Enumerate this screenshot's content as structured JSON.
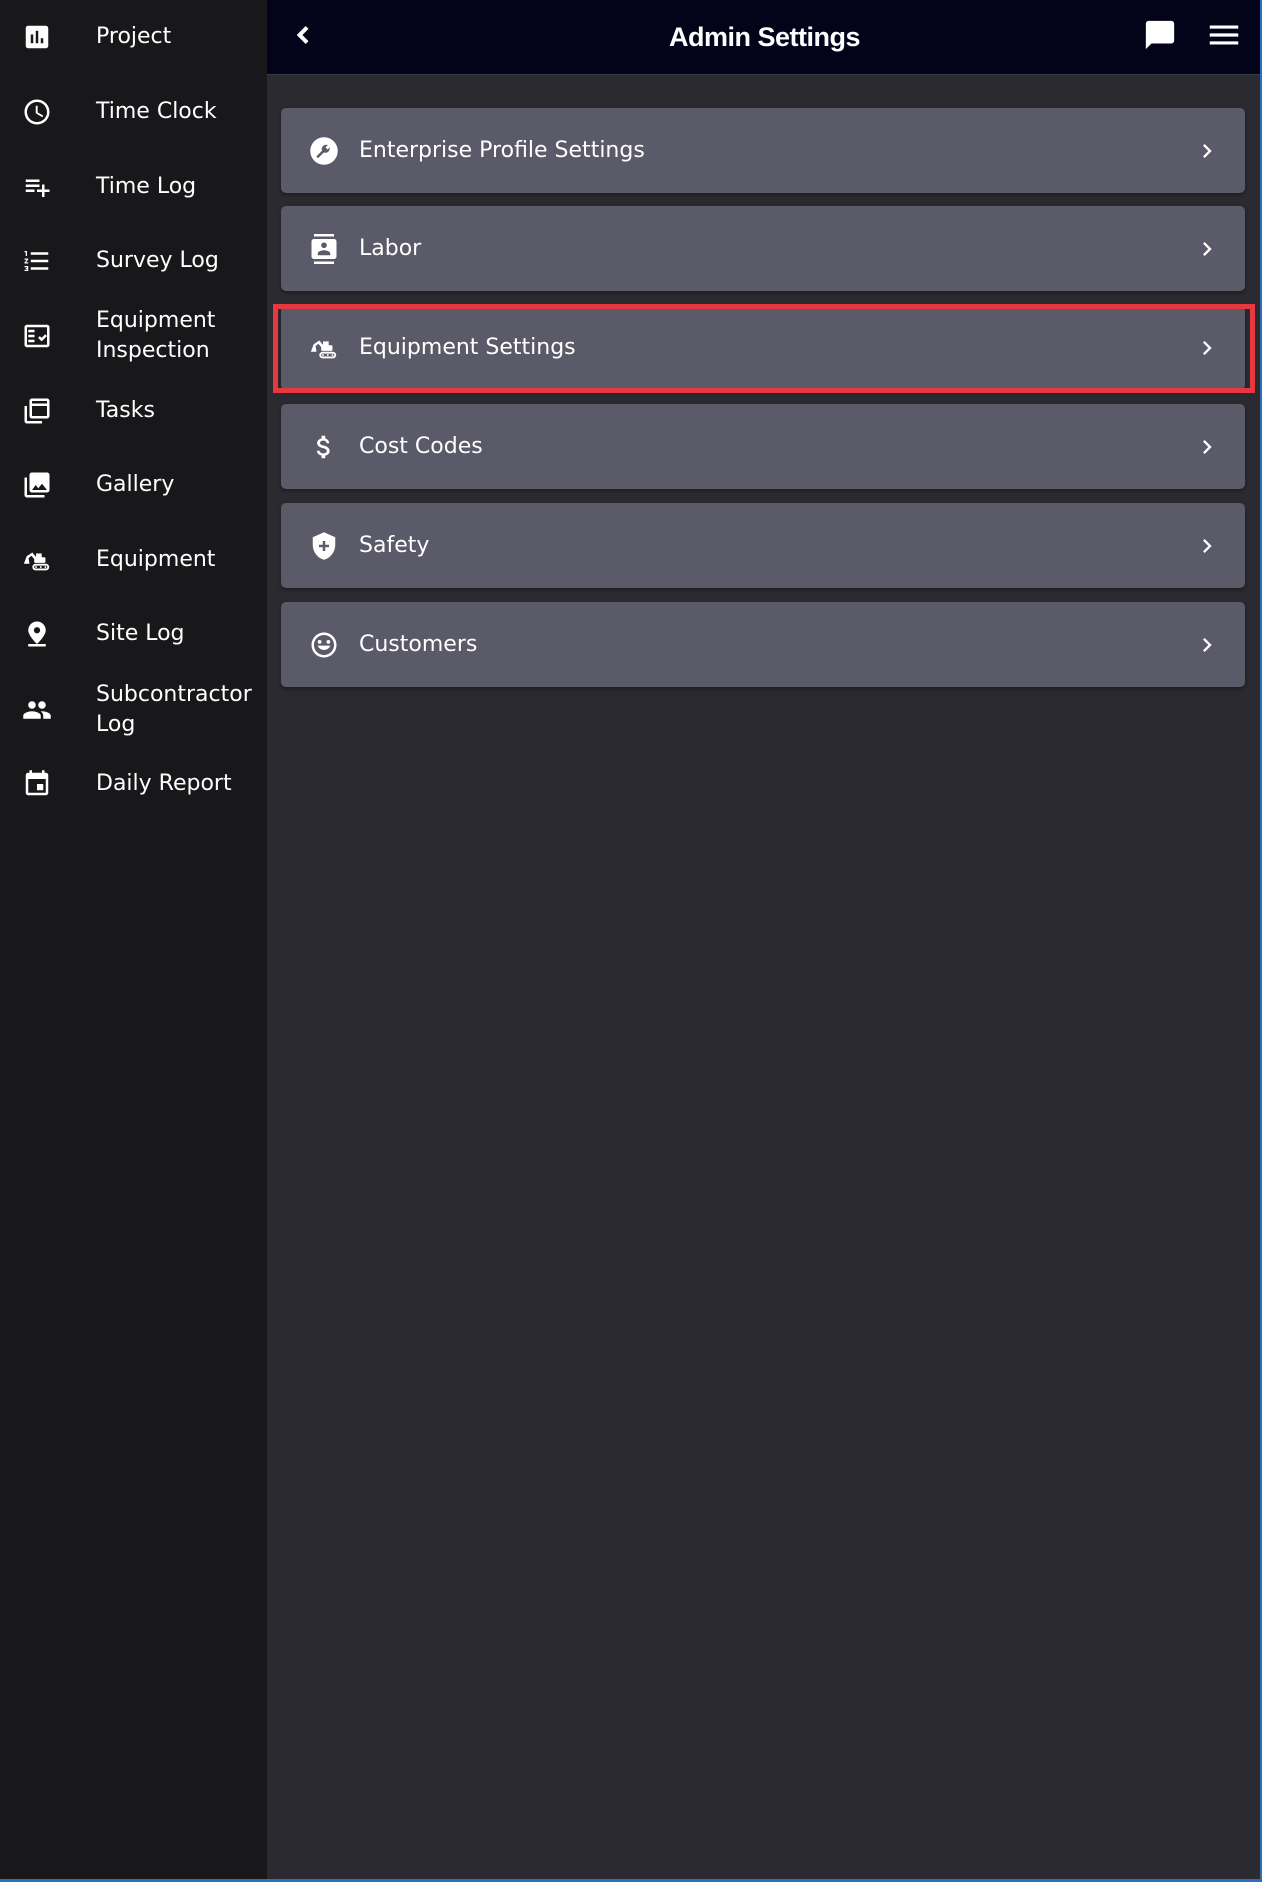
{
  "sidebar": {
    "items": [
      {
        "label": "Project",
        "icon": "bar-chart-icon"
      },
      {
        "label": "Time Clock",
        "icon": "clock-icon"
      },
      {
        "label": "Time Log",
        "icon": "playlist-add-icon"
      },
      {
        "label": "Survey Log",
        "icon": "list-numbered-icon"
      },
      {
        "label": "Equipment\nInspection",
        "icon": "checklist-box-icon"
      },
      {
        "label": "Tasks",
        "icon": "stacked-cards-icon"
      },
      {
        "label": "Gallery",
        "icon": "photo-library-icon"
      },
      {
        "label": "Equipment",
        "icon": "excavator-icon"
      },
      {
        "label": "Site Log",
        "icon": "map-pin-icon"
      },
      {
        "label": "Subcontractor\nLog",
        "icon": "people-icon"
      },
      {
        "label": "Daily Report",
        "icon": "calendar-icon"
      }
    ]
  },
  "header": {
    "title": "Admin Settings",
    "back_icon": "chevron-left-icon",
    "chat_icon": "chat-icon",
    "menu_icon": "hamburger-menu-icon"
  },
  "settings": {
    "items": [
      {
        "label": "Enterprise Profile Settings",
        "icon": "wrench-icon"
      },
      {
        "label": "Labor",
        "icon": "contact-card-icon"
      },
      {
        "label": "Equipment Settings",
        "icon": "excavator-icon",
        "highlighted": true
      },
      {
        "label": "Cost Codes",
        "icon": "dollar-icon"
      },
      {
        "label": "Safety",
        "icon": "shield-plus-icon"
      },
      {
        "label": "Customers",
        "icon": "smiley-icon"
      }
    ]
  },
  "colors": {
    "sidebar_bg": "#18181b",
    "main_bg": "#2a2a30",
    "header_bg": "#03031a",
    "row_bg": "#5b5a68",
    "highlight": "#e8383f"
  }
}
